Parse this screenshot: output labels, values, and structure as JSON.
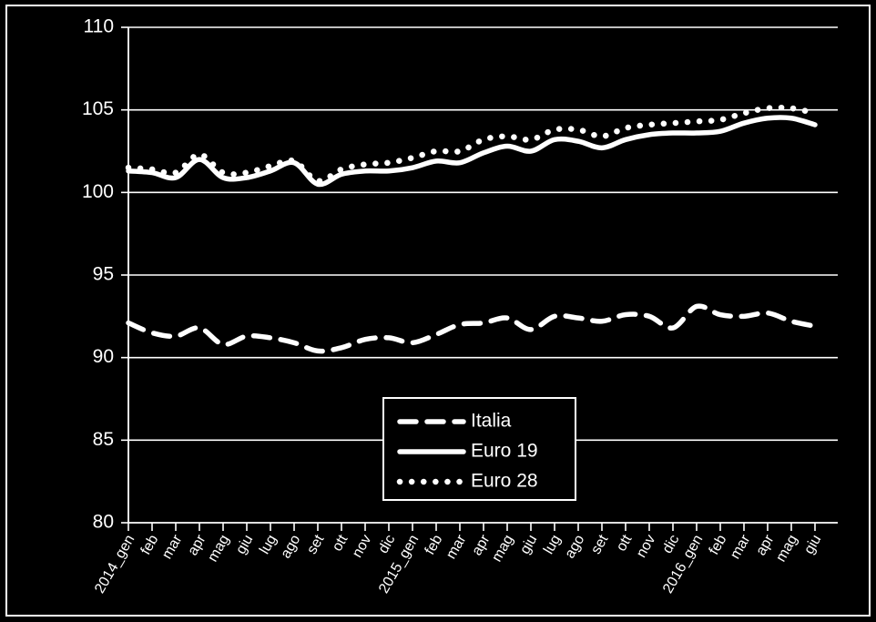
{
  "chart_data": {
    "type": "line",
    "title": "",
    "xlabel": "",
    "ylabel": "",
    "ylim": [
      80,
      110
    ],
    "ytick_values": [
      80,
      85,
      90,
      95,
      100,
      105,
      110
    ],
    "ytick_labels": [
      "80",
      "85",
      "90",
      "95",
      "100",
      "105",
      "110"
    ],
    "grid": true,
    "grid_axis": "y",
    "legend_position": "lower-center",
    "background_color": "#000000",
    "foreground_color": "#ffffff",
    "categories": [
      "2014_gen",
      "feb",
      "mar",
      "apr",
      "mag",
      "giu",
      "lug",
      "ago",
      "set",
      "ott",
      "nov",
      "dic",
      "2015_gen",
      "feb",
      "mar",
      "apr",
      "mag",
      "giu",
      "lug",
      "ago",
      "set",
      "ott",
      "nov",
      "dic",
      "2016_gen",
      "feb",
      "mar",
      "apr",
      "mag",
      "giu"
    ],
    "series": [
      {
        "name": "Italia",
        "style": "dashed",
        "color": "#ffffff",
        "values": [
          92.1,
          91.5,
          91.3,
          91.8,
          90.8,
          91.3,
          91.2,
          90.9,
          90.4,
          90.6,
          91.1,
          91.2,
          90.9,
          91.4,
          92.0,
          92.1,
          92.4,
          91.7,
          92.5,
          92.4,
          92.2,
          92.6,
          92.5,
          91.8,
          93.1,
          92.6,
          92.5,
          92.7,
          92.2,
          91.9
        ]
      },
      {
        "name": "Euro 19",
        "style": "solid",
        "color": "#ffffff",
        "values": [
          101.3,
          101.2,
          100.9,
          102.0,
          100.9,
          100.9,
          101.3,
          101.8,
          100.5,
          101.1,
          101.3,
          101.3,
          101.5,
          101.9,
          101.8,
          102.4,
          102.8,
          102.5,
          103.2,
          103.1,
          102.7,
          103.2,
          103.5,
          103.6,
          103.6,
          103.7,
          104.2,
          104.5,
          104.5,
          104.1
        ]
      },
      {
        "name": "Euro 28",
        "style": "dotted",
        "color": "#ffffff",
        "values": [
          101.5,
          101.4,
          101.2,
          102.3,
          101.2,
          101.2,
          101.6,
          101.9,
          100.7,
          101.4,
          101.7,
          101.8,
          102.1,
          102.5,
          102.5,
          103.2,
          103.4,
          103.2,
          103.8,
          103.8,
          103.4,
          103.9,
          104.1,
          104.2,
          104.3,
          104.4,
          104.8,
          105.1,
          105.1,
          104.8
        ]
      }
    ],
    "legend": [
      {
        "label": "Italia",
        "style": "dashed"
      },
      {
        "label": "Euro 19",
        "style": "solid"
      },
      {
        "label": "Euro 28",
        "style": "dotted"
      }
    ]
  }
}
